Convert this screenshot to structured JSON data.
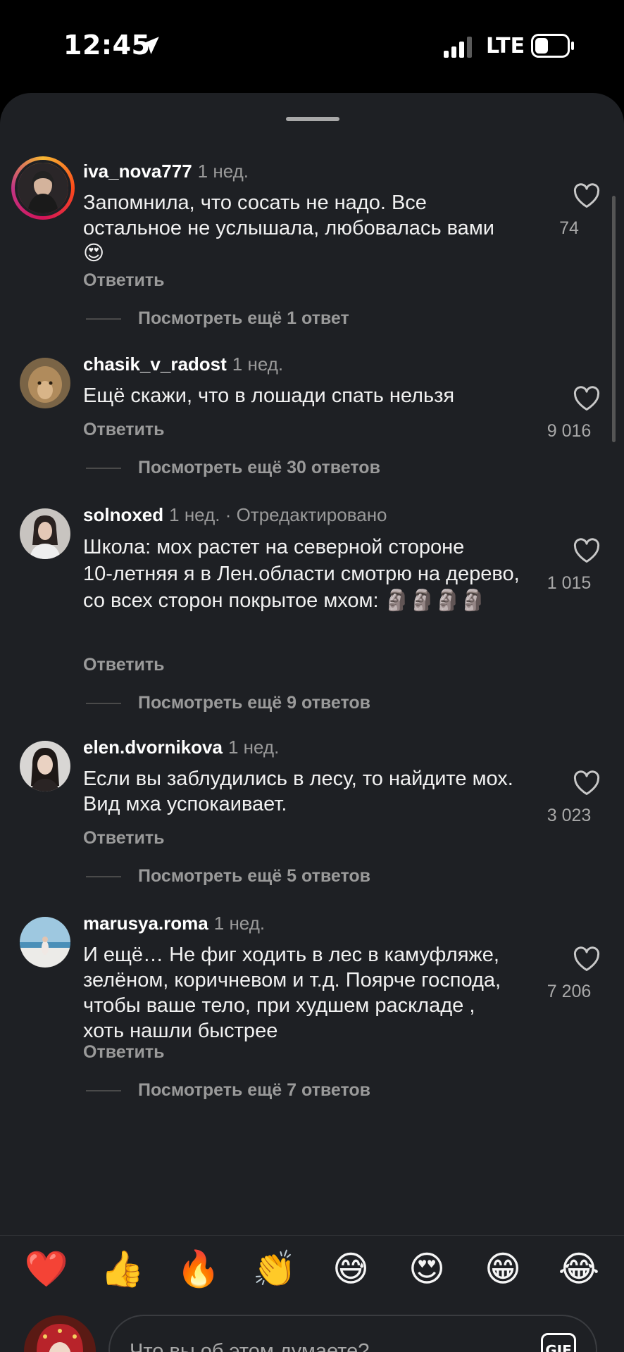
{
  "status_bar": {
    "time": "12:45",
    "network": "LTE"
  },
  "comments": [
    {
      "username": "iva_nova777",
      "time": "1 нед.",
      "edited": "",
      "text": "Запомнила, что сосать не надо. Все остальное не услышала, любовалась вами 😍",
      "reply_label": "Ответить",
      "more_replies": "Посмотреть ещё 1 ответ",
      "likes": "74"
    },
    {
      "username": "chasik_v_radost",
      "time": "1 нед.",
      "edited": "",
      "text": "Ещё скажи, что в лошади спать нельзя",
      "reply_label": "Ответить",
      "more_replies": "Посмотреть ещё 30 ответов",
      "likes": "9 016"
    },
    {
      "username": "solnoxed",
      "time": "1 нед.",
      "edited": "· Отредактировано",
      "text": "Школа: мох растет на северной стороне\n10-летняя я в Лен.области смотрю на дерево, со всех сторон покрытое мхом: 🗿🗿🗿🗿",
      "reply_label": "Ответить",
      "more_replies": "Посмотреть ещё 9 ответов",
      "likes": "1 015"
    },
    {
      "username": "elen.dvornikova",
      "time": "1 нед.",
      "edited": "",
      "text": "Если вы заблудились в лесу, то найдите мох. Вид мха успокаивает.",
      "reply_label": "Ответить",
      "more_replies": "Посмотреть ещё 5 ответов",
      "likes": "3 023"
    },
    {
      "username": "marusya.roma",
      "time": "1 нед.",
      "edited": "",
      "text": "И ещё… Не фиг ходить в лес в камуфляже, зелёном, коричневом и т.д. Поярче господа, чтобы ваше тело, при худшем раскладе , хоть нашли быстрее",
      "reply_label": "Ответить",
      "more_replies": "Посмотреть ещё 7 ответов",
      "likes": "7 206"
    }
  ],
  "quick_reactions": [
    "❤️",
    "👍",
    "🔥",
    "👏",
    "😅",
    "😍",
    "😁",
    "😂"
  ],
  "composer": {
    "placeholder": "Что вы об этом думаете?",
    "gif_label": "GIF"
  }
}
